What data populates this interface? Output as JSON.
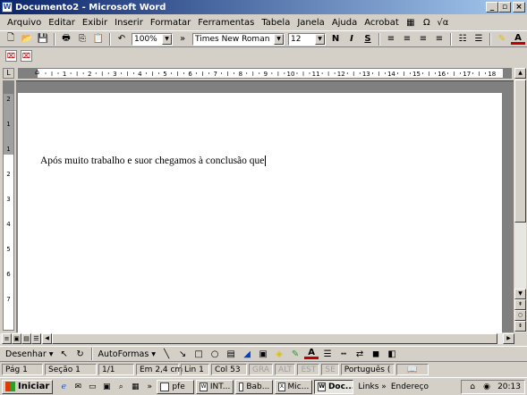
{
  "window": {
    "title": "Documento2 - Microsoft Word",
    "min": "_",
    "max": "▫",
    "close": "×"
  },
  "menu": [
    "Arquivo",
    "Editar",
    "Exibir",
    "Inserir",
    "Formatar",
    "Ferramentas",
    "Tabela",
    "Janela",
    "Ajuda",
    "Acrobat"
  ],
  "menu_extra": [
    "Ω",
    "√α"
  ],
  "toolbar": {
    "zoom": "100%",
    "font": "Times New Roman",
    "size": "12",
    "bold": "N",
    "italic": "I",
    "underline": "S",
    "more": "»"
  },
  "toolbar2": [
    "PDF",
    "PDF"
  ],
  "hruler_marks": [
    "1",
    "2",
    "3",
    "4",
    "5",
    "6",
    "7",
    "8",
    "9",
    "10",
    "11",
    "12",
    "13",
    "14",
    "15",
    "16",
    "17",
    "18"
  ],
  "vruler_marks": [
    "2",
    "1",
    "1",
    "2",
    "3",
    "4",
    "5",
    "6",
    "7"
  ],
  "document": {
    "text": "Após muito trabalho e suor chegamos à conclusão que"
  },
  "drawbar": {
    "draw": "Desenhar ▾",
    "autoshapes": "AutoFormas ▾"
  },
  "status": {
    "page": "Pág 1",
    "section": "Seção 1",
    "pages": "1/1",
    "pos": "Em 2,4 cm",
    "line": "Lin 1",
    "col": "Col 53",
    "grv": "GRA",
    "alt": "ALT",
    "est": "EST",
    "se": "SE",
    "lang": "Português ("
  },
  "taskbar": {
    "start": "Iniciar",
    "more": "»",
    "tasks": [
      "pfe",
      "INT...",
      "Bab...",
      "Mic...",
      "Doc..."
    ],
    "links": "Links »",
    "address": "Endereço",
    "clock": "20:13"
  },
  "colors": {
    "title_start": "#0a246a",
    "title_end": "#a6caf0",
    "chrome": "#d4d0c8",
    "workspace": "#808080"
  }
}
